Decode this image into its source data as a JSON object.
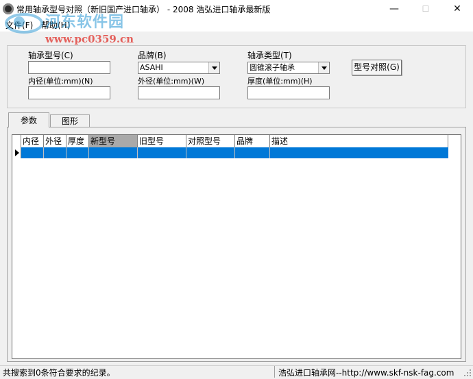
{
  "window": {
    "title": "常用轴承型号对照（新旧国产进口轴承） - 2008 浩弘进口轴承最新版",
    "minimize_glyph": "—",
    "maximize_glyph": "☐",
    "close_glyph": "✕"
  },
  "menu": [
    {
      "label": "文件(F)"
    },
    {
      "label": "帮助(H)"
    }
  ],
  "watermark": {
    "name": "河东软件园",
    "url": "www.pc0359.cn"
  },
  "search": {
    "model_label": "轴承型号(C)",
    "model_value": "",
    "brand_label": "品牌(B)",
    "brand_value": "ASAHI",
    "type_label": "轴承类型(T)",
    "type_value": "圆锥滚子轴承",
    "inner_label": "内径(单位:mm)(N)",
    "inner_value": "",
    "outer_label": "外径(单位:mm)(W)",
    "outer_value": "",
    "thick_label": "厚度(单位:mm)(H)",
    "thick_value": "",
    "compare_button": "型号对照(G)"
  },
  "tabs": [
    {
      "label": "参数",
      "active": true
    },
    {
      "label": "图形",
      "active": false
    }
  ],
  "grid": {
    "columns": [
      "内径",
      "外径",
      "厚度",
      "新型号",
      "旧型号",
      "对照型号",
      "品牌",
      "描述"
    ],
    "rows": [],
    "selected_row_color": "#0078d7"
  },
  "status": {
    "left": "共搜索到0条符合要求的纪录。",
    "right": "浩弘进口轴承网--http://www.skf-nsk-fag.com"
  }
}
